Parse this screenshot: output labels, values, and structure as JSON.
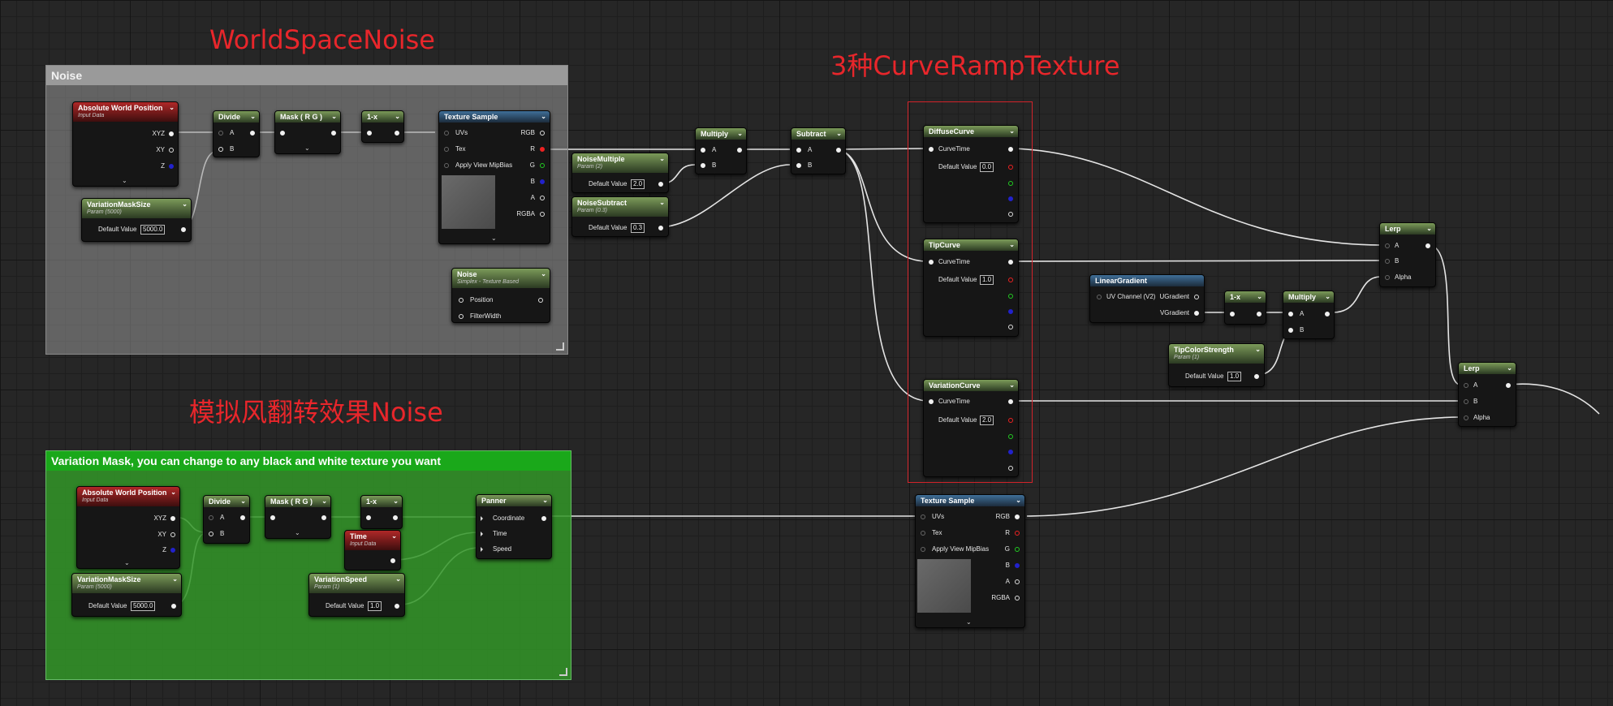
{
  "annotations": {
    "worldspace_noise": "WorldSpaceNoise",
    "curve_ramp": "3种CurveRampTexture",
    "wind_flip": "模拟风翻转效果Noise"
  },
  "comments": {
    "noise": "Noise",
    "variation_mask": "Variation Mask, you can change to any black and white texture you want"
  },
  "common": {
    "chevron": "⌄",
    "a": "A",
    "b": "B",
    "default_value": "Default Value",
    "curve_time": "CurveTime",
    "alpha": "Alpha"
  },
  "nodes": {
    "abs_world_pos": {
      "title": "Absolute World Position",
      "subtitle": "Input Data",
      "pins": [
        "XYZ",
        "XY",
        "Z"
      ]
    },
    "divide": {
      "title": "Divide"
    },
    "mask_rg": {
      "title": "Mask ( R G )"
    },
    "one_minus": {
      "title": "1-x"
    },
    "texture_sample": {
      "title": "Texture Sample",
      "inputs": [
        "UVs",
        "Tex",
        "Apply View MipBias"
      ],
      "outputs": [
        "RGB",
        "R",
        "G",
        "B",
        "A",
        "RGBA"
      ]
    },
    "variation_mask_size": {
      "title": "VariationMaskSize",
      "subtitle": "Param (5000)",
      "value": "5000.0"
    },
    "noise_fn": {
      "title": "Noise",
      "subtitle": "Simplex - Texture Based",
      "pins": [
        "Position",
        "FilterWidth"
      ]
    },
    "noise_multiple": {
      "title": "NoiseMultiple",
      "subtitle": "Param (2)",
      "value": "2.0"
    },
    "noise_subtract": {
      "title": "NoiseSubtract",
      "subtitle": "Param (0.3)",
      "value": "0.3"
    },
    "multiply": {
      "title": "Multiply"
    },
    "subtract": {
      "title": "Subtract"
    },
    "diffuse_curve": {
      "title": "DiffuseCurve",
      "value": "0.0"
    },
    "tip_curve": {
      "title": "TipCurve",
      "value": "1.0"
    },
    "variation_curve": {
      "title": "VariationCurve",
      "value": "2.0"
    },
    "lerp": {
      "title": "Lerp"
    },
    "linear_gradient": {
      "title": "LinearGradient",
      "input": "UV Channel (V2)",
      "outputs": [
        "UGradient",
        "VGradient"
      ]
    },
    "tip_color_strength": {
      "title": "TipColorStrength",
      "subtitle": "Param (1)",
      "value": "1.0"
    },
    "time": {
      "title": "Time",
      "subtitle": "Input Data"
    },
    "panner": {
      "title": "Panner",
      "pins": [
        "Coordinate",
        "Time",
        "Speed"
      ]
    },
    "variation_speed": {
      "title": "VariationSpeed",
      "subtitle": "Param (1)",
      "value": "1.0"
    }
  }
}
